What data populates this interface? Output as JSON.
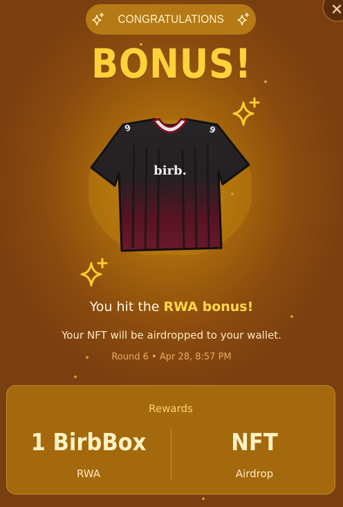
{
  "header": {
    "badge_text": "CONGRATULATIONS",
    "title": "BONUS!"
  },
  "prize": {
    "jersey_text": "birb."
  },
  "message": {
    "headline_prefix": "You hit the ",
    "headline_highlight": "RWA bonus!",
    "subtext": "Your NFT will be airdropped to your wallet.",
    "round_info": "Round 6 • Apr 28, 8:57 PM"
  },
  "rewards": {
    "title": "Rewards",
    "items": [
      {
        "value": "1 BirbBox",
        "label": "RWA"
      },
      {
        "value": "NFT",
        "label": "Airdrop"
      }
    ]
  },
  "colors": {
    "accent_gold": "#ffd23a",
    "background": "#8a4b0e",
    "card": "#a4690c"
  },
  "icons": [
    "close-icon",
    "sparkle-icon"
  ]
}
